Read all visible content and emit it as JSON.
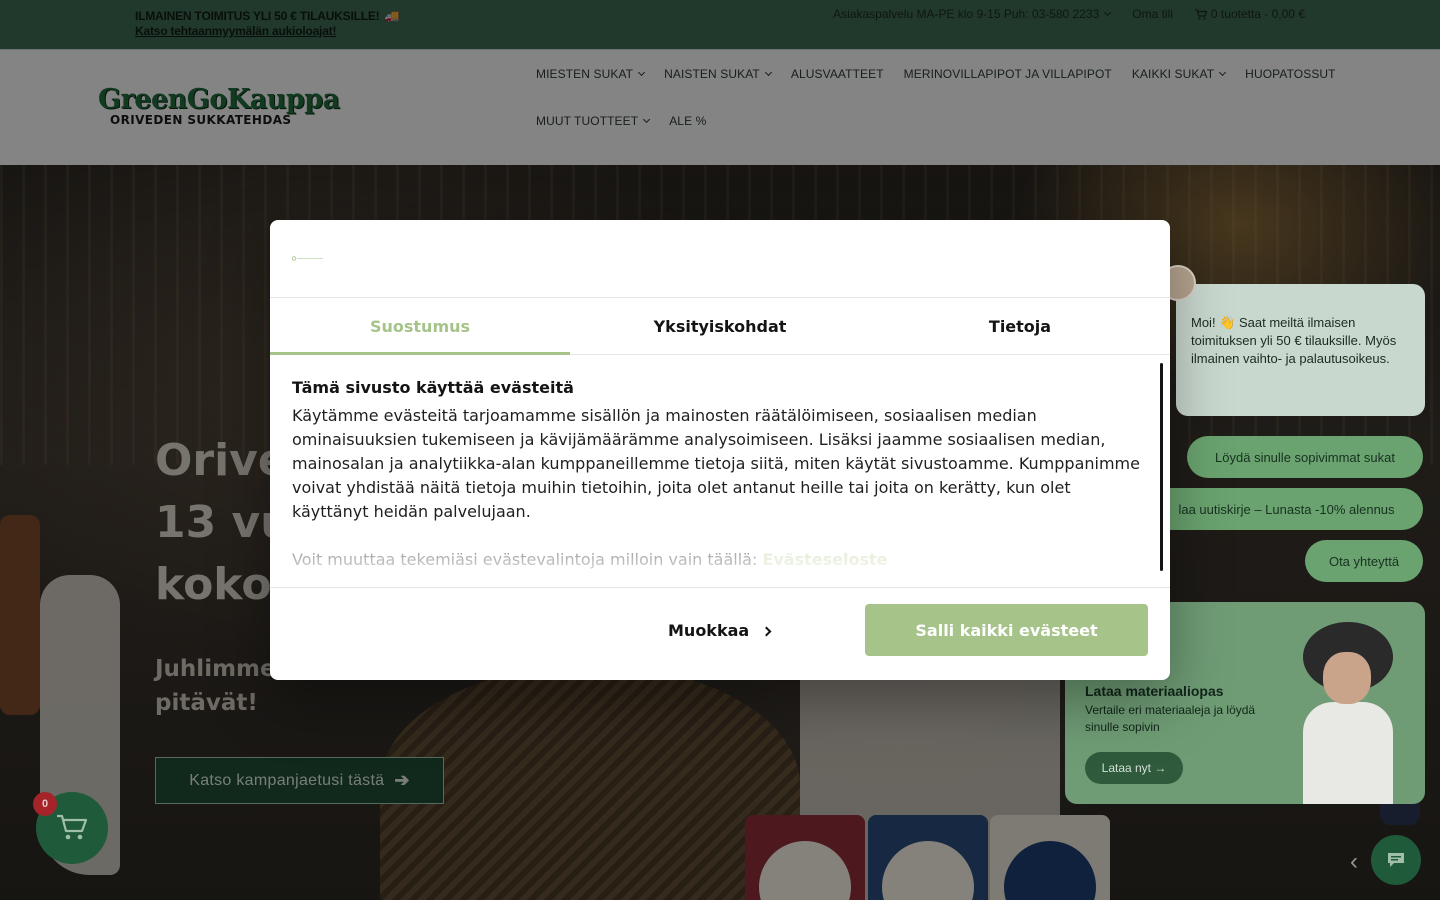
{
  "topbar": {
    "promo": "ILMAINEN TOIMITUS YLI 50 € TILAUKSILLE!",
    "promo_icon": "🚚",
    "promo_link": "Katso tehtaanmyymälän aukioloajat!",
    "customer_service": "Asiakaspalvelu MA-PE klo 9-15 Puh: 03-580 2233",
    "account": "Oma tili",
    "cart": "0 tuotetta - 0,00 €"
  },
  "header": {
    "logo_line1": "GreenGoKauppa",
    "logo_line2": "ORIVEDEN SUKKATEHDAS",
    "nav": [
      {
        "label": "MIESTEN SUKAT"
      },
      {
        "label": "NAISTEN SUKAT"
      },
      {
        "label": "ALUSVAATTEET"
      },
      {
        "label": "MERINOVILLAPIPOT JA VILLAPIPOT"
      },
      {
        "label": "KAIKKI SUKAT"
      },
      {
        "label": "HUOPATOSSUT"
      },
      {
        "label": "MUUT TUOTTEET"
      },
      {
        "label": "ALE %"
      }
    ]
  },
  "hero": {
    "title_line1": "Orive",
    "title_line2": "13 vu",
    "title_line3": "koko",
    "subtitle_line1": "Juhlimme",
    "subtitle_line2": "pitävät!",
    "cta": "Katso kampanjaetusi tästä"
  },
  "chat": {
    "message": "Moi! 👋 Saat meiltä ilmaisen toimituksen yli 50 € tilauksille. Myös ilmainen vaihto- ja palautusoikeus.",
    "chip1": "Löydä sinulle sopivimmat sukat",
    "chip2": "laa uutiskirje – Lunasta -10% alennus",
    "chip3": "Ota yhteyttä",
    "card_title": "Lataa materiaaliopas",
    "card_desc": "Vertaile eri materiaaleja ja löydä sinulle sopivin",
    "card_btn": "Lataa nyt →"
  },
  "cart_badge": "0",
  "cookie": {
    "tabs": [
      "Suostumus",
      "Yksityiskohdat",
      "Tietoja"
    ],
    "heading": "Tämä sivusto käyttää evästeitä",
    "text": "Käytämme evästeitä tarjoamamme sisällön ja mainosten räätälöimiseen, sosiaalisen median ominaisuuksien tukemiseen ja kävijämäärämme analysoimiseen. Lisäksi jaamme sosiaalisen median, mainosalan ja analytiikka-alan kumppaneillemme tietoja siitä, miten käytät sivustoamme. Kumppanimme voivat yhdistää näitä tietoja muihin tietoihin, joita olet antanut heille tai joita on kerätty, kun olet käyttänyt heidän palvelujaan.",
    "more_text": "Voit muuttaa tekemiäsi evästevalintoja milloin vain täällä:",
    "more_link": "Evästeseloste",
    "customize": "Muokkaa",
    "allow_all": "Salli kaikki evästeet"
  },
  "colors": {
    "topbar": "#3d6651",
    "brand_green": "#1f5a3a",
    "consent_accent": "#a6c48a"
  }
}
